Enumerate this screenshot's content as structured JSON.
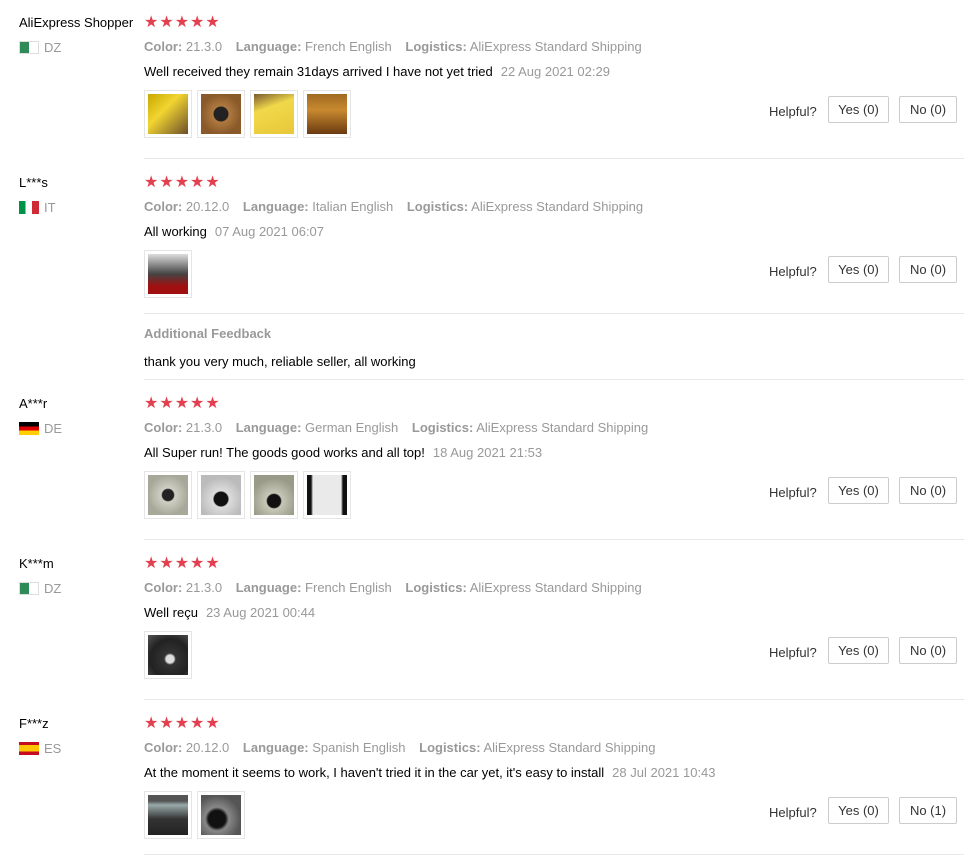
{
  "helpful_label": "Helpful?",
  "star_glyphs": "★★★★★",
  "labels": {
    "color": "Color:",
    "language": "Language:",
    "logistics": "Logistics:"
  },
  "reviews": [
    {
      "user": "AliExpress Shopper",
      "country": "DZ",
      "flag": "dz-flag-icon",
      "stars": 5,
      "color": "21.3.0",
      "language": "French English",
      "logistics": "AliExpress Standard Shipping",
      "text": "Well received they remain 31days arrived I have not yet tried",
      "date": "22 Aug 2021 02:29",
      "photos": 4,
      "yes": "Yes (0)",
      "no": "No (0)"
    },
    {
      "user": "L***s",
      "country": "IT",
      "flag": "it-flag-icon",
      "stars": 5,
      "color": "20.12.0",
      "language": "Italian English",
      "logistics": "AliExpress Standard Shipping",
      "text": "All working",
      "date": "07 Aug 2021 06:07",
      "photos": 1,
      "yes": "Yes (0)",
      "no": "No (0)",
      "additional_title": "Additional Feedback",
      "additional_text": "thank you very much, reliable seller, all working"
    },
    {
      "user": "A***r",
      "country": "DE",
      "flag": "de-flag-icon",
      "stars": 5,
      "color": "21.3.0",
      "language": "German English",
      "logistics": "AliExpress Standard Shipping",
      "text": "All Super run! The goods good works and all top!",
      "date": "18 Aug 2021 21:53",
      "photos": 4,
      "yes": "Yes (0)",
      "no": "No (0)"
    },
    {
      "user": "K***m",
      "country": "DZ",
      "flag": "dz-flag-icon",
      "stars": 5,
      "color": "21.3.0",
      "language": "French English",
      "logistics": "AliExpress Standard Shipping",
      "text": "Well reçu",
      "date": "23 Aug 2021 00:44",
      "photos": 1,
      "yes": "Yes (0)",
      "no": "No (0)"
    },
    {
      "user": "F***z",
      "country": "ES",
      "flag": "es-flag-icon",
      "stars": 5,
      "color": "20.12.0",
      "language": "Spanish English",
      "logistics": "AliExpress Standard Shipping",
      "text": "At the moment it seems to work, I haven't tried it in the car yet, it's easy to install",
      "date": "28 Jul 2021 10:43",
      "photos": 2,
      "yes": "Yes (0)",
      "no": "No (1)"
    }
  ]
}
